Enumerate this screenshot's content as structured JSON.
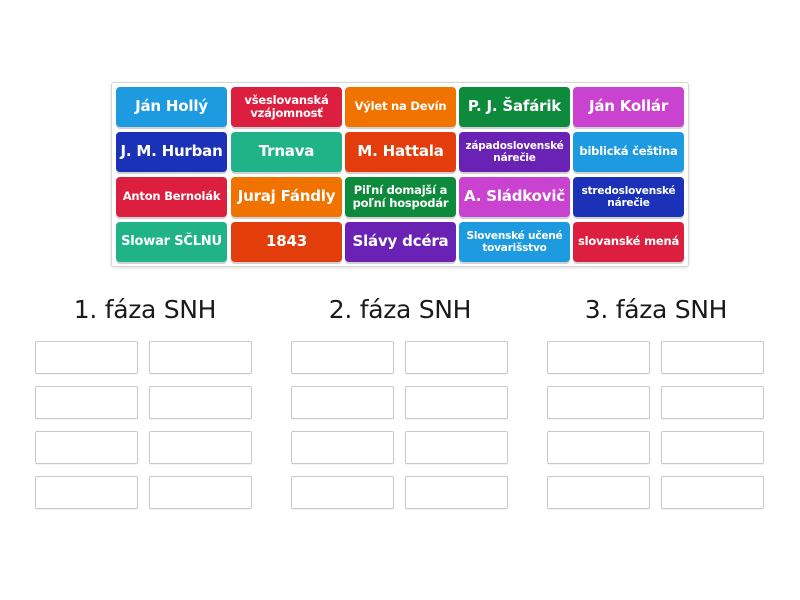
{
  "pool": {
    "tiles": [
      {
        "label": "Ján Hollý",
        "color": "#1e9be0",
        "size": "big"
      },
      {
        "label": "všeslovanská vzájomnosť",
        "color": "#dd1f3f",
        "size": "small"
      },
      {
        "label": "Výlet na Devín",
        "color": "#f07300",
        "size": "small"
      },
      {
        "label": "P. J. Šafárik",
        "color": "#0e8a3c",
        "size": "big"
      },
      {
        "label": "Ján Kollár",
        "color": "#c943d0",
        "size": "big"
      },
      {
        "label": "J. M. Hurban",
        "color": "#1a31b8",
        "size": "big"
      },
      {
        "label": "Trnava",
        "color": "#1fb387",
        "size": "big"
      },
      {
        "label": "M. Hattala",
        "color": "#e33d0b",
        "size": "big"
      },
      {
        "label": "západoslovenské nárečie",
        "color": "#6a22b5",
        "size": "xsmall"
      },
      {
        "label": "biblická čeština",
        "color": "#1e9be0",
        "size": "small"
      },
      {
        "label": "Anton Bernolák",
        "color": "#dd1f3f",
        "size": "small"
      },
      {
        "label": "Juraj Fándly",
        "color": "#f07300",
        "size": "big"
      },
      {
        "label": "Piľní domajší a poľní hospodár",
        "color": "#0e8a3c",
        "size": "small"
      },
      {
        "label": "A. Sládkovič",
        "color": "#c943d0",
        "size": "big"
      },
      {
        "label": "stredoslovenské nárečie",
        "color": "#1a31b8",
        "size": "xsmall"
      },
      {
        "label": "Slowar SČLNU",
        "color": "#1fb387",
        "size": "med"
      },
      {
        "label": "1843",
        "color": "#e33d0b",
        "size": "big"
      },
      {
        "label": "Slávy dcéra",
        "color": "#6a22b5",
        "size": "big"
      },
      {
        "label": "Slovenské učené tovarišstvo",
        "color": "#1e9be0",
        "size": "xsmall"
      },
      {
        "label": "slovanské mená",
        "color": "#dd1f3f",
        "size": "small"
      }
    ]
  },
  "groups": [
    {
      "title": "1. fáza SNH",
      "slots": 8
    },
    {
      "title": "2. fáza SNH",
      "slots": 8
    },
    {
      "title": "3. fáza SNH",
      "slots": 8
    }
  ]
}
